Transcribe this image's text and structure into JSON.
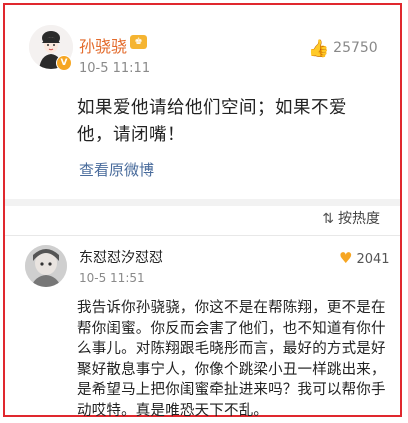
{
  "comment1": {
    "author": "孙骁骁",
    "level_icon": "level-badge-icon",
    "verified_icon": "v-icon",
    "time": "10-5 11:11",
    "likes": "25750",
    "text": "如果爱他请给他们空间；如果不爱他，请闭嘴！",
    "view_original": "查看原微博"
  },
  "sort": {
    "label": "按热度"
  },
  "comment2": {
    "author": "东怼怼汐怼怼",
    "time": "10-5 11:51",
    "likes": "2041",
    "text": "我告诉你孙骁骁，你这不是在帮陈翔，更不是在帮你闺蜜。你反而会害了他们，也不知道有你什么事儿。对陈翔跟毛晓彤而言，最好的方式是好聚好散息事宁人，你像个跳梁小丑一样跳出来，是希望马上把你闺蜜牵扯进来吗？我可以帮你手动哎特。真是唯恐天下不乱。"
  },
  "colors": {
    "frame": "#e0282e",
    "author_orange": "#e36b2c",
    "link_blue": "#4a6c9c",
    "heart": "#f6a623"
  }
}
